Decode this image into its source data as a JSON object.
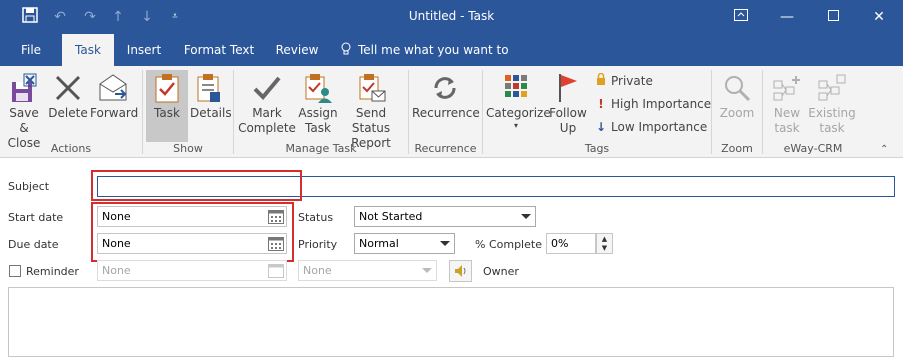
{
  "window": {
    "title": "Untitled - Task"
  },
  "tabs": [
    {
      "label": "File"
    },
    {
      "label": "Task"
    },
    {
      "label": "Insert"
    },
    {
      "label": "Format Text"
    },
    {
      "label": "Review"
    },
    {
      "label": "Tell me what you want to do"
    }
  ],
  "ribbon": {
    "actions": {
      "save_close": "Save &\nClose",
      "delete": "Delete",
      "forward": "Forward",
      "group": "Actions"
    },
    "show": {
      "task": "Task",
      "details": "Details",
      "group": "Show"
    },
    "manage": {
      "mark_complete": "Mark\nComplete",
      "assign_task": "Assign\nTask",
      "send_status": "Send Status\nReport",
      "group": "Manage Task"
    },
    "recurrence": {
      "recurrence": "Recurrence",
      "group": "Recurrence"
    },
    "tags": {
      "categorize": "Categorize",
      "follow_up": "Follow\nUp",
      "private": "Private",
      "high": "High Importance",
      "low": "Low Importance",
      "group": "Tags"
    },
    "zoom": {
      "zoom": "Zoom",
      "group": "Zoom"
    },
    "eway": {
      "new_task": "New\ntask",
      "existing_task": "Existing\ntask",
      "group": "eWay-CRM"
    }
  },
  "form": {
    "subject_label": "Subject",
    "subject_value": "",
    "start_label": "Start date",
    "start_value": "None",
    "due_label": "Due date",
    "due_value": "None",
    "status_label": "Status",
    "status_value": "Not Started",
    "priority_label": "Priority",
    "priority_value": "Normal",
    "complete_label": "% Complete",
    "complete_value": "0%",
    "reminder_label": "Reminder",
    "reminder_date": "None",
    "reminder_time": "None",
    "owner_label": "Owner"
  },
  "colors": {
    "accent": "#2b579a",
    "highlight": "#d32f2f"
  }
}
